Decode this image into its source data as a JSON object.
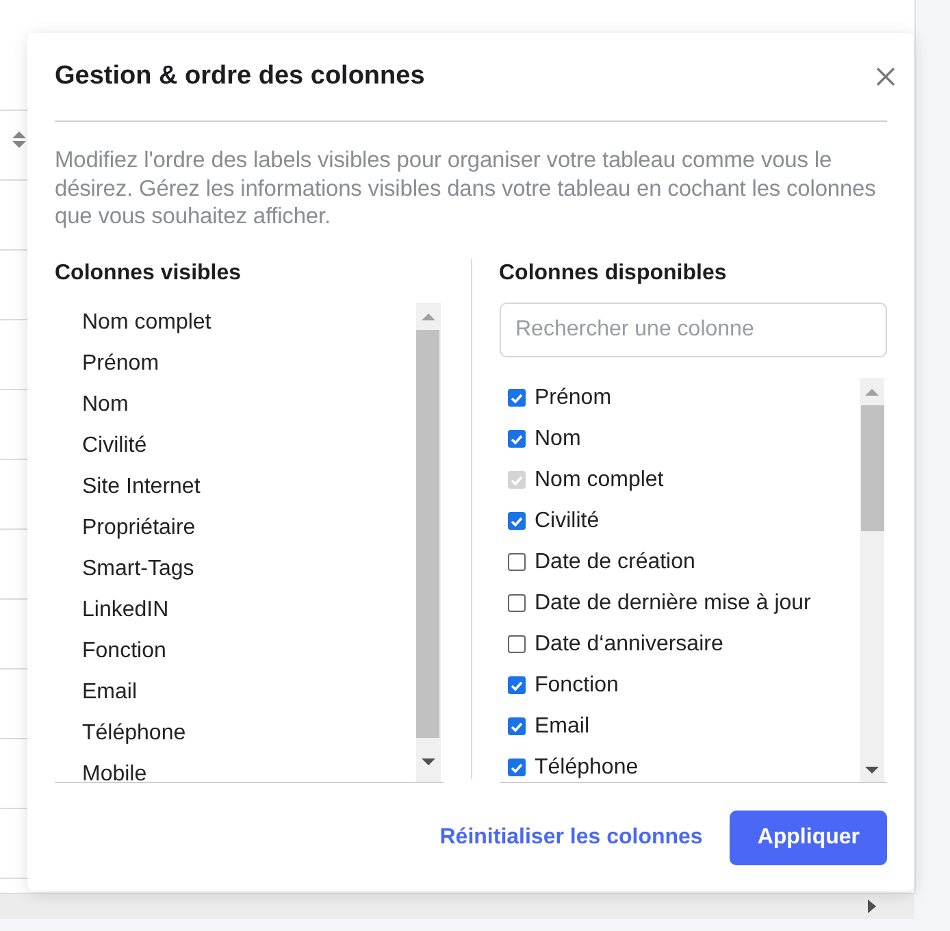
{
  "dialog": {
    "title": "Gestion & ordre des colonnes",
    "description": "Modifiez l'ordre des labels visibles pour organiser votre tableau comme vous le désirez. Gérez les informations visibles dans votre tableau en cochant les colonnes que vous souhaitez afficher."
  },
  "visible_columns": {
    "heading": "Colonnes visibles",
    "items": [
      "Nom complet",
      "Prénom",
      "Nom",
      "Civilité",
      "Site Internet",
      "Propriétaire",
      "Smart-Tags",
      "LinkedIN",
      "Fonction",
      "Email",
      "Téléphone",
      "Mobile"
    ]
  },
  "available_columns": {
    "heading": "Colonnes disponibles",
    "search": {
      "placeholder": "Rechercher une colonne"
    },
    "items": [
      {
        "label": "Prénom",
        "checked": true,
        "disabled": false
      },
      {
        "label": "Nom",
        "checked": true,
        "disabled": false
      },
      {
        "label": "Nom complet",
        "checked": true,
        "disabled": true
      },
      {
        "label": "Civilité",
        "checked": true,
        "disabled": false
      },
      {
        "label": "Date de création",
        "checked": false,
        "disabled": false
      },
      {
        "label": "Date de dernière mise à jour",
        "checked": false,
        "disabled": false
      },
      {
        "label": "Date d‘anniversaire",
        "checked": false,
        "disabled": false
      },
      {
        "label": "Fonction",
        "checked": true,
        "disabled": false
      },
      {
        "label": "Email",
        "checked": true,
        "disabled": false
      },
      {
        "label": "Téléphone",
        "checked": true,
        "disabled": false
      }
    ]
  },
  "buttons": {
    "reset": "Réinitialiser les colonnes",
    "apply": "Appliquer"
  }
}
